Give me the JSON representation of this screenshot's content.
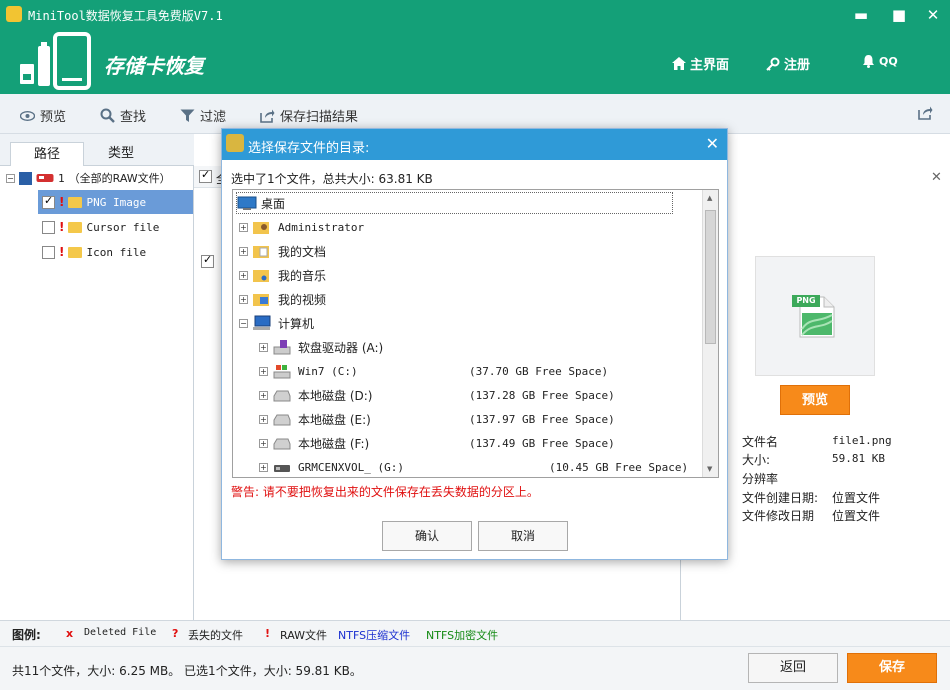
{
  "window": {
    "title": "MiniTool数据恢复工具免费版V7.1",
    "min": "▬",
    "max": "■",
    "close": "✕"
  },
  "header": {
    "app_name": "存储卡恢复",
    "nav": [
      {
        "label": "主界面",
        "icon": "home-icon"
      },
      {
        "label": "注册",
        "icon": "key-icon"
      },
      {
        "label": "QQ",
        "icon": "bell-icon"
      }
    ]
  },
  "toolbar": {
    "preview": "预览",
    "find": "查找",
    "filter": "过滤",
    "save_scan": "保存扫描结果"
  },
  "tabs": [
    "路径",
    "类型"
  ],
  "tree": {
    "root_num": "1",
    "root_label": "（全部的RAW文件）",
    "items": [
      "PNG Image",
      "Cursor file",
      "Icon file"
    ]
  },
  "middle": {
    "header_text": "全"
  },
  "right": {
    "preview_btn": "预览",
    "png_badge": "PNG",
    "info": [
      {
        "label": "文件名",
        "value": "file1.png"
      },
      {
        "label": "大小:",
        "value": "59.81 KB"
      },
      {
        "label": "分辨率",
        "value": ""
      },
      {
        "label": "文件创建日期:",
        "value": "位置文件"
      },
      {
        "label": "文件修改日期",
        "value": "位置文件"
      }
    ]
  },
  "legend": {
    "title": "图例:",
    "items": [
      {
        "symbol": "x",
        "label": "Deleted File"
      },
      {
        "symbol": "?",
        "label": "丢失的文件"
      },
      {
        "symbol": "!",
        "label": "RAW文件"
      },
      {
        "symbol": "",
        "label": "NTFS压缩文件"
      },
      {
        "symbol": "",
        "label": "NTFS加密文件"
      }
    ],
    "colors": {
      "red": "#e01010",
      "ntfs_compressed": "#1a2fd0",
      "ntfs_encrypted": "#148a14"
    }
  },
  "status": {
    "text": "共11个文件，大小: 6.25 MB。 已选1个文件，大小: 59.81 KB。",
    "return": "返回",
    "save": "保存"
  },
  "dialog": {
    "title": "选择保存文件的目录:",
    "close": "✕",
    "summary": "选中了1个文件，总共大小: 63.81 KB",
    "rows": [
      {
        "label": "桌面",
        "free": ""
      },
      {
        "label": "Administrator",
        "free": ""
      },
      {
        "label": "我的文档",
        "free": ""
      },
      {
        "label": "我的音乐",
        "free": ""
      },
      {
        "label": "我的视频",
        "free": ""
      },
      {
        "label": "计算机",
        "free": ""
      },
      {
        "label": "软盘驱动器 (A:)",
        "free": ""
      },
      {
        "label": "Win7 (C:)",
        "free": "(37.70 GB Free Space)"
      },
      {
        "label": "本地磁盘 (D:)",
        "free": "(137.28 GB Free Space)"
      },
      {
        "label": "本地磁盘 (E:)",
        "free": "(137.97 GB Free Space)"
      },
      {
        "label": "本地磁盘 (F:)",
        "free": "(137.49 GB Free Space)"
      },
      {
        "label": "GRMCENXVOL_ (G:)",
        "free": "(10.45 GB Free Space)"
      }
    ],
    "warning": "警告: 请不要把恢复出来的文件保存在丢失数据的分区上。",
    "ok": "确认",
    "cancel": "取消"
  },
  "theme": {
    "header_green": "#14a078",
    "accent_orange": "#f78a1a",
    "dialog_blue": "#2f9ad7"
  }
}
